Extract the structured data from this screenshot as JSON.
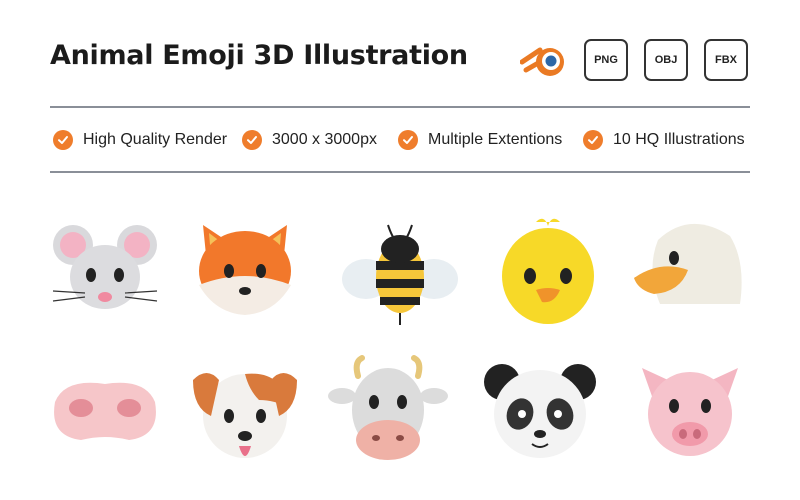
{
  "header": {
    "title": "Animal Emoji 3D Illustration",
    "formats": [
      "PNG",
      "OBJ",
      "FBX"
    ]
  },
  "features": [
    "High Quality Render",
    "3000 x 3000px",
    "Multiple Extentions",
    "10 HQ Illustrations"
  ],
  "accent_color": "#ef7d2c",
  "icons": {
    "software": "blender-logo-icon",
    "check": "check-circle-icon"
  },
  "illustrations": [
    "mouse-emoji-icon",
    "fox-emoji-icon",
    "bee-emoji-icon",
    "chick-emoji-icon",
    "duck-emoji-icon",
    "pig-nose-emoji-icon",
    "dog-emoji-icon",
    "cow-emoji-icon",
    "panda-emoji-icon",
    "pig-emoji-icon"
  ]
}
